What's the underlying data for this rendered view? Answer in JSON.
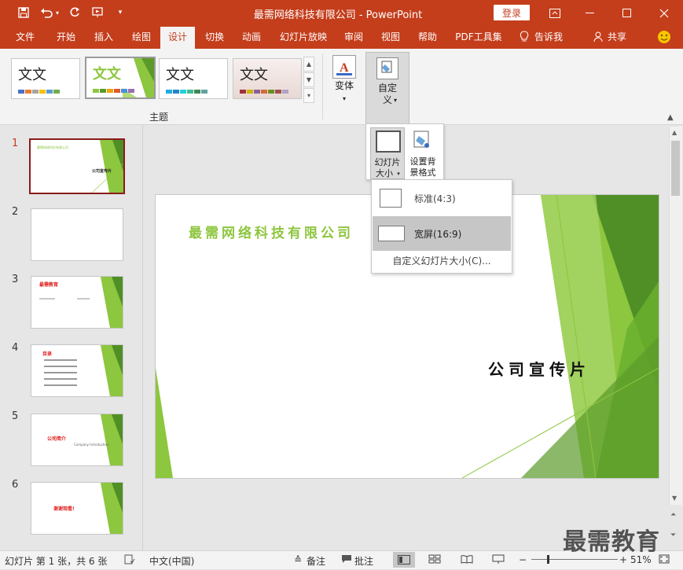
{
  "window": {
    "title": "最需网络科技有限公司  -  PowerPoint",
    "login_label": "登录"
  },
  "tabs": [
    "文件",
    "开始",
    "插入",
    "绘图",
    "设计",
    "切换",
    "动画",
    "幻灯片放映",
    "审阅",
    "视图",
    "帮助",
    "PDF工具集"
  ],
  "active_tab": "设计",
  "tell_me": "告诉我",
  "share": "共享",
  "ribbon": {
    "themes_group_label": "主题",
    "theme_sample_text": "文文",
    "variants_label": "变体",
    "customize_label_1": "自定",
    "customize_label_2": "义"
  },
  "size_gallery": {
    "slide_size_label_1": "幻灯片",
    "slide_size_label_2": "大小",
    "format_bg_label_1": "设置背",
    "format_bg_label_2": "景格式"
  },
  "size_menu": {
    "standard": "标准(4:3)",
    "widescreen": "宽屏(16:9)",
    "custom": "自定义幻灯片大小(C)..."
  },
  "thumbnails": [
    {
      "num": "1"
    },
    {
      "num": "2"
    },
    {
      "num": "3"
    },
    {
      "num": "4"
    },
    {
      "num": "5"
    },
    {
      "num": "6"
    }
  ],
  "thumb_text": {
    "t1_title": "最需网络科技有限公司",
    "t1_sub": "公司宣传片",
    "t3_title": "最需教育",
    "t4_title": "目录",
    "t5_title": "公司简介",
    "t5_sub": "Company Introduction",
    "t6_title": "谢谢观看!"
  },
  "slide": {
    "title": "最需网络科技有限公司",
    "subtitle": "公司宣传片"
  },
  "status": {
    "slide_info": "幻灯片 第 1 张，共 6 张",
    "language": "中文(中国)",
    "notes": "备注",
    "comments": "批注",
    "zoom": "51%"
  },
  "watermark": "最需教育",
  "colors": {
    "accent": "#c43e1c",
    "green": "#8dc63f"
  }
}
